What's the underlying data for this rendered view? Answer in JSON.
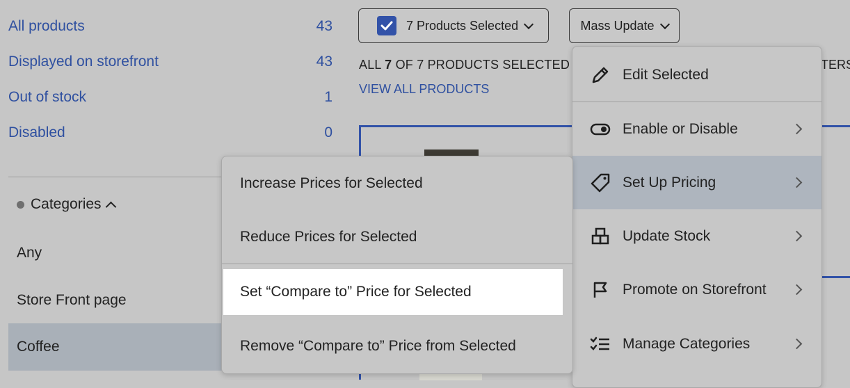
{
  "filters": [
    {
      "label": "All products",
      "count": "43"
    },
    {
      "label": "Displayed on storefront",
      "count": "43"
    },
    {
      "label": "Out of stock",
      "count": "1"
    },
    {
      "label": "Disabled",
      "count": "0"
    }
  ],
  "categories": {
    "header": "Categories",
    "items": [
      "Any",
      "Store Front page",
      "Coffee"
    ]
  },
  "toolbar": {
    "selected_label": "7 Products Selected",
    "mass_update_label": "Mass Update"
  },
  "selection": {
    "prefix": "ALL ",
    "count": "7",
    "suffix": " OF 7 PRODUCTS SELECTED",
    "view_all": "VIEW ALL PRODUCTS",
    "filters_fragment": "TERS:"
  },
  "mass_update_menu": [
    {
      "label": "Edit Selected",
      "icon": "pencil-icon"
    },
    {
      "label": "Enable or Disable",
      "icon": "toggle-icon"
    },
    {
      "label": "Set Up Pricing",
      "icon": "price-tag-icon"
    },
    {
      "label": "Update Stock",
      "icon": "boxes-icon"
    },
    {
      "label": "Promote on Storefront",
      "icon": "flag-icon"
    },
    {
      "label": "Manage Categories",
      "icon": "checklist-icon"
    }
  ],
  "pricing_submenu": [
    "Increase Prices for Selected",
    "Reduce Prices for Selected",
    "Set “Compare to” Price for Selected",
    "Remove “Compare to” Price from Selected"
  ],
  "colors": {
    "link_blue": "#2f50a0",
    "accent_blue": "#3252a8",
    "highlight": "#ffffff"
  }
}
